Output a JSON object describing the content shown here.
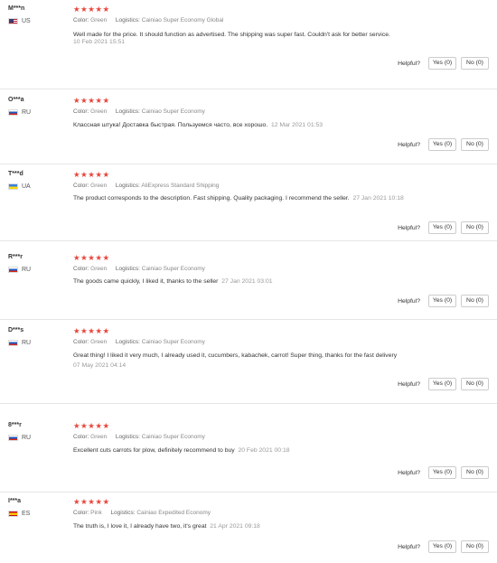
{
  "helpful_label": "Helpful?",
  "reviews": [
    {
      "user": "M***n",
      "country": "US",
      "flag": "us",
      "stars": "★★★★★",
      "color_label": "Color:",
      "color": "Green",
      "logistics_label": "Logistics:",
      "logistics": "Cainiao Super Economy Global",
      "text": "Well made for the price. It should function as advertised. The shipping was super fast. Couldn't ask for better service.",
      "date": "10 Feb 2021 15:51",
      "yes": "Yes (0)",
      "no": "No (0)"
    },
    {
      "user": "O***a",
      "country": "RU",
      "flag": "ru",
      "stars": "★★★★★",
      "color_label": "Color:",
      "color": "Green",
      "logistics_label": "Logistics:",
      "logistics": "Cainiao Super Economy",
      "text": "Классная штука! Доставка быстрая. Пользуемся часто, все хорошо.",
      "date": "12 Mar 2021 01:53",
      "yes": "Yes (0)",
      "no": "No (0)"
    },
    {
      "user": "T***d",
      "country": "UA",
      "flag": "ua",
      "stars": "★★★★★",
      "color_label": "Color:",
      "color": "Green",
      "logistics_label": "Logistics:",
      "logistics": "AliExpress Standard Shipping",
      "text": "The product corresponds to the description. Fast shipping. Quality packaging. I recommend the seller.",
      "date": "27 Jan 2021 10:18",
      "yes": "Yes (0)",
      "no": "No (0)"
    },
    {
      "user": "R***r",
      "country": "RU",
      "flag": "ru",
      "stars": "★★★★★",
      "color_label": "Color:",
      "color": "Green",
      "logistics_label": "Logistics:",
      "logistics": "Cainiao Super Economy",
      "text": "The goods came quickly, I liked it, thanks to the seller",
      "date": "27 Jan 2021 03:01",
      "yes": "Yes (0)",
      "no": "No (0)"
    },
    {
      "user": "D***s",
      "country": "RU",
      "flag": "ru",
      "stars": "★★★★★",
      "color_label": "Color:",
      "color": "Green",
      "logistics_label": "Logistics:",
      "logistics": "Cainiao Super Economy",
      "text": "Great thing! I liked it very much, I already used it, cucumbers, kabachek, carrot! Super thing, thanks for the fast delivery",
      "date": "07 May 2021 04:14",
      "yes": "Yes (0)",
      "no": "No (0)"
    },
    {
      "user": "8***r",
      "country": "RU",
      "flag": "ru",
      "stars": "★★★★★",
      "color_label": "Color:",
      "color": "Green",
      "logistics_label": "Logistics:",
      "logistics": "Cainiao Super Economy",
      "text": "Excellent cuts carrots for plow, definitely recommend to buy",
      "date": "20 Feb 2021 00:18",
      "yes": "Yes (0)",
      "no": "No (0)"
    },
    {
      "user": "I***a",
      "country": "ES",
      "flag": "es",
      "stars": "★★★★★",
      "color_label": "Color:",
      "color": "Pink",
      "logistics_label": "Logistics:",
      "logistics": "Cainiao Expedited Economy",
      "text": "The truth is, I love it, I already have two, it's great",
      "date": "21 Apr 2021 09:18",
      "yes": "Yes (0)",
      "no": "No (0)"
    }
  ],
  "colors": {
    "star": "#e8463c",
    "divider": "#e6e6e6",
    "muted": "#999999"
  }
}
